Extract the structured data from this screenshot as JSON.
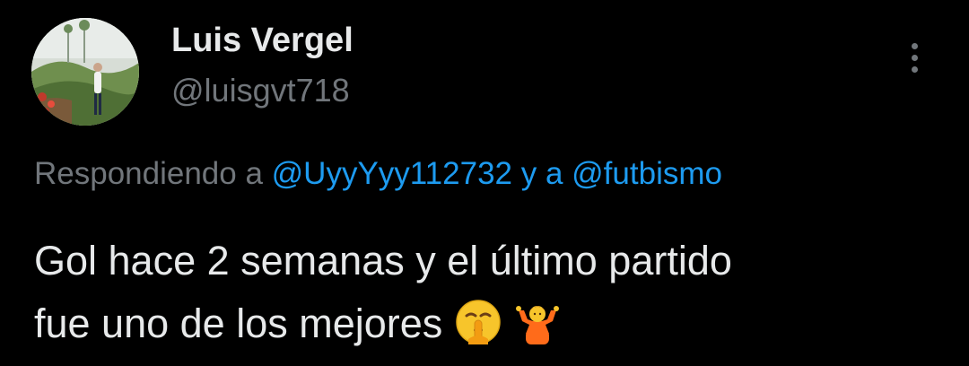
{
  "author": {
    "display_name": "Luis Vergel",
    "handle": "@luisgvt718",
    "avatar_icon": "profile-photo"
  },
  "menu": {
    "more_icon": "more-vertical-icon"
  },
  "reply": {
    "prefix": "Respondiendo a ",
    "mention_1": "@UyyYyy112732",
    "joiner": " y a ",
    "mention_2": "@futbismo"
  },
  "tweet": {
    "line_1": "Gol hace 2 semanas y el último partido",
    "line_2": "fue uno de los mejores",
    "emojis": [
      "shushing-face-emoji",
      "person-shrugging-emoji"
    ]
  },
  "colors": {
    "background": "#000000",
    "primary_text": "#e7e9ea",
    "secondary_text": "#71767b",
    "link": "#1d9bf0"
  }
}
